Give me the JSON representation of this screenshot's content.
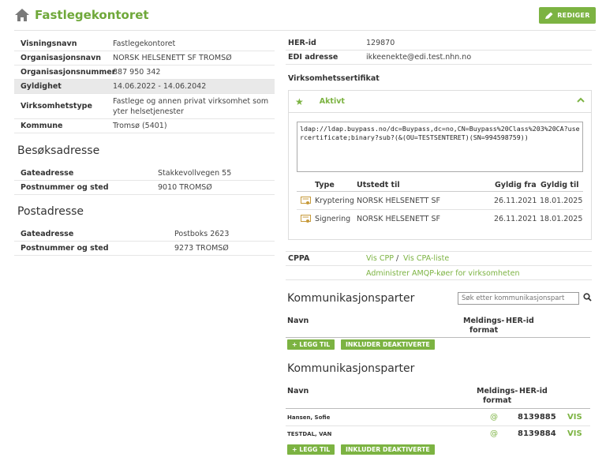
{
  "header": {
    "title": "Fastlegekontoret",
    "edit_label": "REDIGER"
  },
  "colors": {
    "accent": "#7cb342"
  },
  "left": {
    "rows": [
      {
        "key": "Visningsnavn",
        "value": "Fastlegekontoret"
      },
      {
        "key": "Organisasjonsnavn",
        "value": "NORSK HELSENETT SF TROMSØ"
      },
      {
        "key": "Organisasjonsnummer",
        "value": "887 950 342"
      },
      {
        "key": "Gyldighet",
        "value": "14.06.2022 - 14.06.2042"
      },
      {
        "key": "Virksomhetstype",
        "value": "Fastlege og annen privat virksomhet som",
        "value2": "yter helsetjenester"
      },
      {
        "key": "Kommune",
        "value": "Tromsø (5401)"
      }
    ],
    "visit": {
      "title": "Besøksadresse",
      "rows": [
        {
          "key": "Gateadresse",
          "value": "Stakkevollvegen 55"
        },
        {
          "key": "Postnummer og sted",
          "value": "9010 TROMSØ"
        }
      ]
    },
    "post": {
      "title": "Postadresse",
      "rows": [
        {
          "key": "Gateadresse",
          "value": "Postboks 2623"
        },
        {
          "key": "Postnummer og sted",
          "value": "9273 TROMSØ"
        }
      ]
    }
  },
  "right": {
    "her_key": "HER-id",
    "her_value": "129870",
    "edi_key": "EDI adresse",
    "edi_value": "ikkeenekte@edi.test.nhn.no",
    "cert_title": "Virksomhetssertifikat",
    "cert_status": "Aktivt",
    "ldap": "ldap://ldap.buypass.no/dc=Buypass,dc=no,CN=Buypass%20Class%203%20CA?usercertificate;binary?sub?(&(OU=TESTSENTERET)(SN=994598759))",
    "cert_table": {
      "headers": [
        "Type",
        "Utstedt til",
        "Gyldig fra",
        "Gyldig til"
      ],
      "rows": [
        [
          "Kryptering",
          "NORSK HELSENETT SF",
          "26.11.2021",
          "18.01.2025"
        ],
        [
          "Signering",
          "NORSK HELSENETT SF",
          "26.11.2021",
          "18.01.2025"
        ]
      ]
    },
    "cppa_key": "CPPA",
    "vis_cpp": "Vis CPP",
    "sep": "/",
    "vis_cpa": "Vis CPA-liste",
    "amqp": "Administrer AMQP-køer for virksomheten",
    "komm1": {
      "title": "Kommunikasjonsparter",
      "search_placeholder": "Søk etter kommunikasjonspart",
      "col_name": "Navn",
      "col_format1": "Meldings-",
      "col_format2": "format",
      "col_her": "HER-id",
      "add": "+ LEGG TIL",
      "include": "INKLUDER DEAKTIVERTE"
    },
    "komm2": {
      "title": "Kommunikasjonsparter",
      "col_name": "Navn",
      "col_format1": "Meldings-",
      "col_format2": "format",
      "col_her": "HER-id",
      "rows": [
        {
          "name": "Hansen, Sofie",
          "format": "@",
          "her": "8139885",
          "action": "VIS"
        },
        {
          "name": "TESTDAL, VAN",
          "format": "@",
          "her": "8139884",
          "action": "VIS"
        }
      ],
      "add": "+ LEGG TIL",
      "include": "INKLUDER DEAKTIVERTE"
    }
  }
}
